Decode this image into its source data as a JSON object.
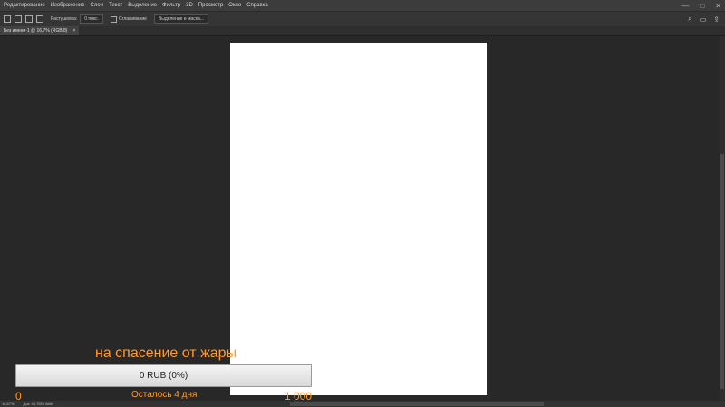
{
  "menubar": {
    "items": [
      "Редактирование",
      "Изображение",
      "Слои",
      "Текст",
      "Выделение",
      "Фильтр",
      "3D",
      "Просмотр",
      "Окно",
      "Справка"
    ],
    "window_controls": [
      "—",
      "□",
      "✕"
    ]
  },
  "options": {
    "feather_label": "Растушевка:",
    "feather_value": "0 пикс.",
    "antialias_label": "Сглаживание",
    "select_mask_label": "Выделение и маска..."
  },
  "document_tab": {
    "title": "Без имени-1 @ 16,7% (RGB/8)",
    "close": "×"
  },
  "status": {
    "zoom": "16,67%",
    "doc": "Док: 44,7М/0 байт"
  },
  "donation_overlay": {
    "title": "на спасение от жары",
    "progress_text": "0 RUB (0%)",
    "progress_fraction": 0,
    "min_label": "0",
    "remaining_label": "Осталось 4 дня",
    "goal_label": "1 000",
    "accent_color": "#ff9a2e"
  }
}
